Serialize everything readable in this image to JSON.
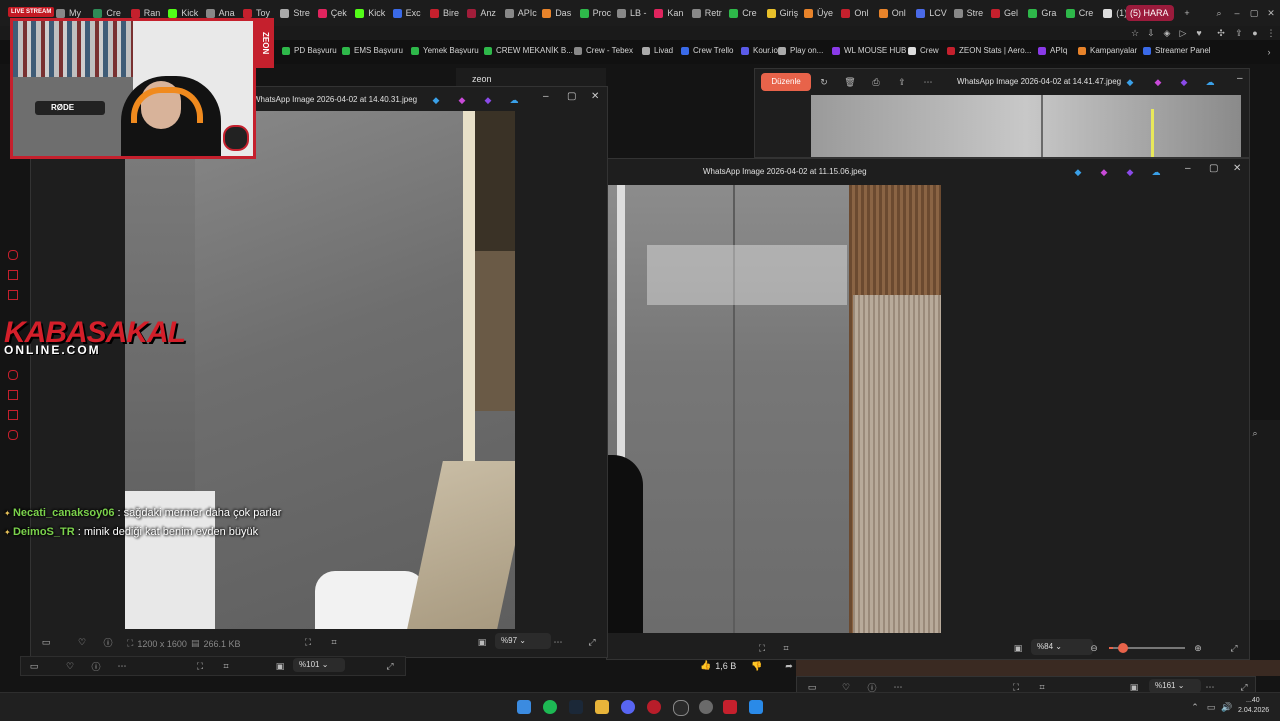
{
  "browser": {
    "live_badge": "LIVE STREAM",
    "tabs": [
      "My",
      "Cre",
      "Ran",
      "Kick",
      "Ana",
      "Toy",
      "Stre",
      "Çek",
      "Kick",
      "Exc",
      "Bire",
      "Anz",
      "APIc",
      "Das",
      "Proc",
      "LB -",
      "Kan",
      "Retr",
      "Cre",
      "Giriş",
      "Üye",
      "Onl",
      "Onl",
      "LCV",
      "Stre",
      "Gel",
      "Gra",
      "Cre",
      "(1) N"
    ],
    "active_tab": "(5) HARA",
    "bookmarks": [
      "PD Başvuru",
      "EMS Başvuru",
      "Yemek Başvuru",
      "CREW MEKANİK B...",
      "Crew - Tebex",
      "Livad",
      "Crew Trello",
      "Kour.io",
      "Play on...",
      "WL MOUSE HUB",
      "Crew",
      "ZEON Stats | Aero...",
      "APIq",
      "Kampanyalar",
      "Streamer Panel"
    ],
    "colors": {
      "accent_red": "#c5202d",
      "active_tab": "#9b1b3c"
    }
  },
  "overlay": {
    "rode_label": "RØDE",
    "zeon_label": "ZEON",
    "logo_line1": "KABASAKAL",
    "logo_line2": "ONLINE.COM",
    "chat": [
      {
        "user": "Necati_canaksoy06",
        "message": " : sağdaki mermer daha çok parlar"
      },
      {
        "user": "DeimoS_TR",
        "message": " : minik dediği kat benim evden büyük"
      }
    ],
    "zeon_search_text": "zeon"
  },
  "viewer_left": {
    "title": "WhatsApp Image 2026-04-02 at 14.40.31.jpeg",
    "dimensions": "1200 x 1600",
    "filesize": "266.1 KB",
    "zoom": "%97",
    "bottom_zoom": "%101"
  },
  "viewer_right_back": {
    "title": "WhatsApp Image 2026-04-02 at 14.41.47.jpeg",
    "edit_label": "Düzenle"
  },
  "viewer_right": {
    "title": "WhatsApp Image 2026-04-02 at 11.15.06.jpeg",
    "zoom": "%84",
    "bottom_zoom": "%161",
    "zoom_level": 0.05
  },
  "video": {
    "likes": "1,6 B"
  },
  "taskbar": {
    "time": "...40",
    "date": "2.04.2026"
  }
}
